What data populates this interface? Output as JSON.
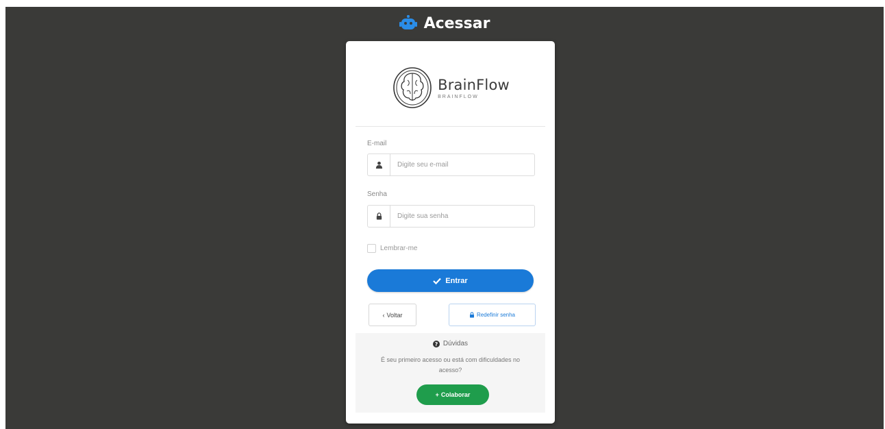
{
  "header": {
    "title": "Acessar",
    "icon": "robot-icon"
  },
  "brand": {
    "name": "BrainFlow",
    "tagline": "BRAINFLOW",
    "icon": "brain-icon"
  },
  "form": {
    "email": {
      "label": "E-mail",
      "placeholder": "Digite seu e-mail",
      "icon": "user-icon"
    },
    "password": {
      "label": "Senha",
      "placeholder": "Digite sua senha",
      "icon": "lock-icon"
    },
    "remember_label": "Lembrar-me",
    "enter_label": "Entrar",
    "back_label": "Voltar",
    "reset_label": "Redefinir senha"
  },
  "help": {
    "title": "Dúvidas",
    "text": "É seu primeiro acesso ou está com dificuldades no acesso?",
    "collab_label": "Colaborar"
  },
  "colors": {
    "background": "#3a3a38",
    "primary": "#1a7ad8",
    "success": "#1f9d4c",
    "card": "#ffffff"
  }
}
